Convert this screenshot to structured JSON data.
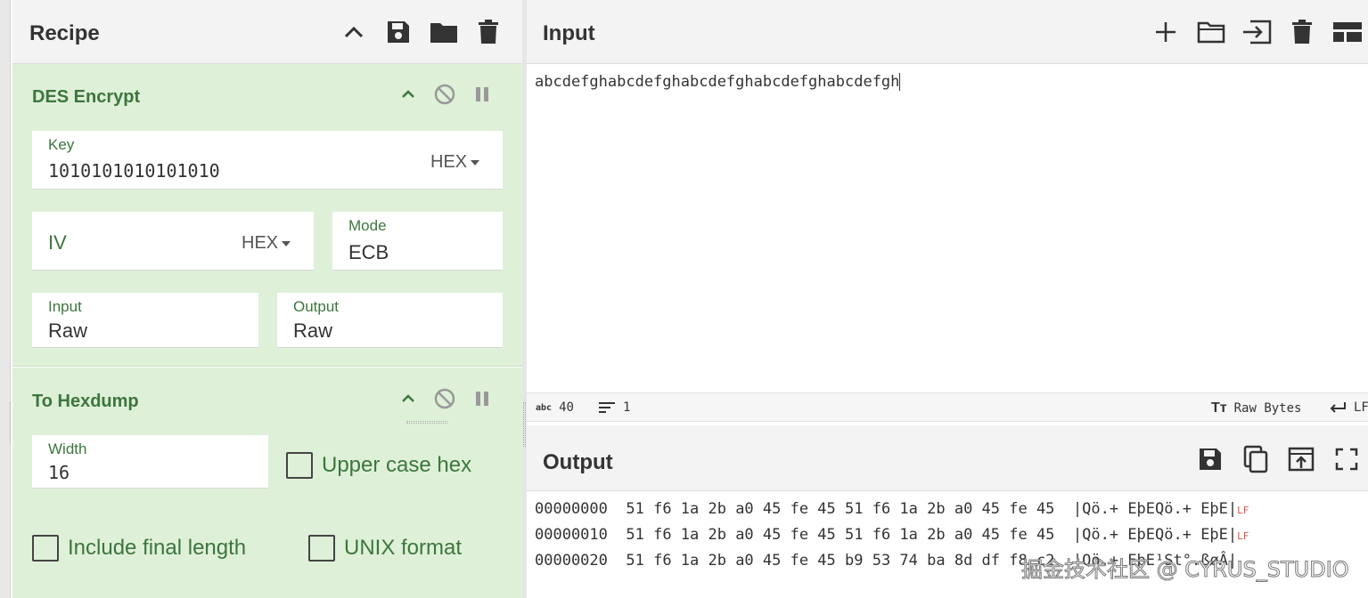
{
  "recipe": {
    "title": "Recipe",
    "header_icons": [
      "chevron-up-icon",
      "save-icon",
      "folder-icon",
      "trash-icon"
    ]
  },
  "operations": {
    "des": {
      "title": "DES Encrypt",
      "key": {
        "label": "Key",
        "value": "1010101010101010",
        "format": "HEX"
      },
      "iv": {
        "label": "IV",
        "value": "",
        "format": "HEX"
      },
      "mode": {
        "label": "Mode",
        "value": "ECB"
      },
      "input": {
        "label": "Input",
        "value": "Raw"
      },
      "output": {
        "label": "Output",
        "value": "Raw"
      }
    },
    "hexdump": {
      "title": "To Hexdump",
      "width": {
        "label": "Width",
        "value": "16"
      },
      "upper_case_hex": {
        "label": "Upper case hex",
        "checked": false
      },
      "include_final_length": {
        "label": "Include final length",
        "checked": false
      },
      "unix_format": {
        "label": "UNIX format",
        "checked": false
      }
    }
  },
  "input_pane": {
    "title": "Input",
    "text": "abcdefghabcdefghabcdefghabcdefghabcdefgh",
    "status": {
      "length_icon": "abc",
      "length": "40",
      "lines": "1",
      "encoding": "Raw Bytes",
      "eol": "LF"
    }
  },
  "output_pane": {
    "title": "Output",
    "lines": [
      {
        "offset": "00000000",
        "hex": "51 f6 1a 2b a0 45 fe 45 51 f6 1a 2b a0 45 fe 45",
        "ascii": "|Qö.+ EþEQö.+ EþE|",
        "eol": "LF"
      },
      {
        "offset": "00000010",
        "hex": "51 f6 1a 2b a0 45 fe 45 51 f6 1a 2b a0 45 fe 45",
        "ascii": "|Qö.+ EþEQö.+ EþE|",
        "eol": "LF"
      },
      {
        "offset": "00000020",
        "hex": "51 f6 1a 2b a0 45 fe 45 b9 53 74 ba 8d df f8 c2",
        "ascii": "|Qö.+ EþE¹St°.ßøÂ|",
        "eol": ""
      }
    ]
  },
  "watermark": "掘金技术社区 @ CYRUS_STUDIO",
  "colors": {
    "accent_green": "#3c763d",
    "op_bg": "#dff0d8",
    "lf_red": "#d9534f"
  }
}
